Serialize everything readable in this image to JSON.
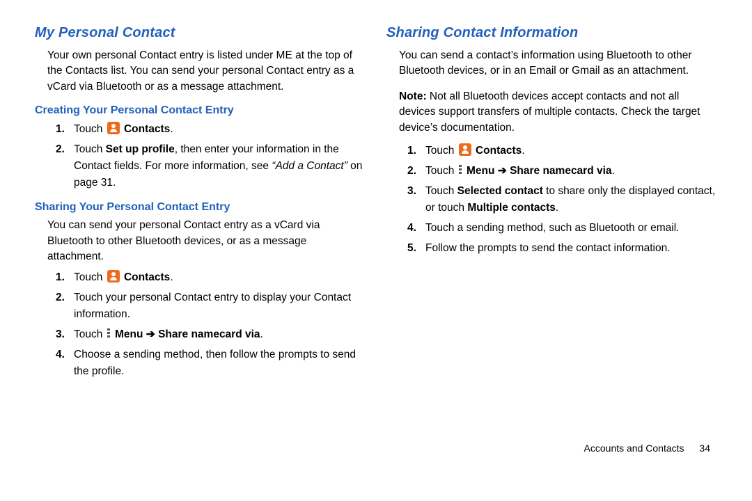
{
  "left": {
    "title": "My Personal Contact",
    "intro": "Your own personal Contact entry is listed under ME at the top of the Contacts list. You can send your personal Contact entry as a vCard via Bluetooth or as a message attachment.",
    "sectionA": {
      "heading": "Creating Your Personal Contact Entry",
      "steps": [
        {
          "n": "1.",
          "pre": "Touch ",
          "iconLabel": "Contacts",
          "post": "."
        },
        {
          "n": "2.",
          "pre": "Touch ",
          "bold1": "Set up profile",
          "mid": ", then enter your information in the Contact fields. For more information, see ",
          "ref": "“Add a Contact”",
          "post": " on page 31."
        }
      ]
    },
    "sectionB": {
      "heading": "Sharing Your Personal Contact Entry",
      "intro": "You can send your personal Contact entry as a vCard via Bluetooth to other Bluetooth devices, or as a message attachment.",
      "steps": [
        {
          "n": "1.",
          "pre": "Touch ",
          "iconLabel": "Contacts",
          "post": "."
        },
        {
          "n": "2.",
          "text": "Touch your personal Contact entry to display your Contact information."
        },
        {
          "n": "3.",
          "pre": "Touch ",
          "menuLabel": "Menu",
          "arrow": " ➔ ",
          "bold2": "Share namecard via",
          "post": "."
        },
        {
          "n": "4.",
          "text": "Choose a sending method, then follow the prompts to send the profile."
        }
      ]
    }
  },
  "right": {
    "title": "Sharing Contact Information",
    "intro": "You can send a contact’s information using Bluetooth to other Bluetooth devices, or in an Email or Gmail as an attachment.",
    "note": {
      "label": "Note:",
      "text": " Not all Bluetooth devices accept contacts and not all devices support transfers of multiple contacts. Check the target device’s documentation."
    },
    "steps": [
      {
        "n": "1.",
        "pre": "Touch ",
        "iconLabel": "Contacts",
        "post": "."
      },
      {
        "n": "2.",
        "pre": "Touch ",
        "menuLabel": "Menu",
        "arrow": " ➔ ",
        "bold2": "Share namecard via",
        "post": "."
      },
      {
        "n": "3.",
        "pre": "Touch ",
        "bold1": "Selected contact",
        "mid": " to share only the displayed contact, or touch ",
        "bold2": "Multiple contacts",
        "post": "."
      },
      {
        "n": "4.",
        "text": "Touch a sending method, such as Bluetooth or email."
      },
      {
        "n": "5.",
        "text": "Follow the prompts to send the contact information."
      }
    ]
  },
  "footer": {
    "section": "Accounts and Contacts",
    "page": "34"
  }
}
